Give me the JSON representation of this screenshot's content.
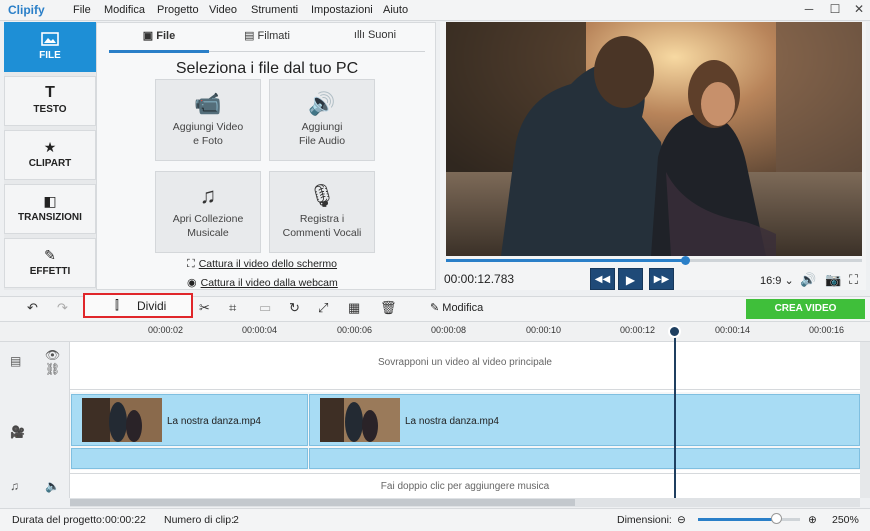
{
  "app": {
    "logo": "Clipify",
    "window_controls": [
      "─",
      "☐",
      "✕"
    ]
  },
  "menu": [
    "File",
    "Modifica",
    "Progetto",
    "Video",
    "Strumenti",
    "Impostazioni",
    "Aiuto"
  ],
  "leftnav": [
    {
      "label": "FILE",
      "icon": "image-icon",
      "active": true
    },
    {
      "label": "TESTO",
      "icon": "text-icon"
    },
    {
      "label": "CLIPART",
      "icon": "star-icon"
    },
    {
      "label": "TRANSIZIONI",
      "icon": "transition-icon"
    },
    {
      "label": "EFFETTI",
      "icon": "magic-wand-icon"
    }
  ],
  "tabs": [
    {
      "label": "File",
      "icon": "image-icon"
    },
    {
      "label": "Filmati",
      "icon": "film-icon"
    },
    {
      "label": "Suoni",
      "icon": "sound-wave-icon"
    }
  ],
  "filepanel": {
    "title": "Seleziona i file dal tuo PC",
    "tiles": [
      {
        "label": "Aggiungi Video e Foto",
        "icon": "camera-icon"
      },
      {
        "label": "Aggiungi File Audio",
        "icon": "audio-file-icon"
      },
      {
        "label": "Apri Collezione Musicale",
        "icon": "music-notes-icon"
      },
      {
        "label": "Registra i Commenti Vocali",
        "icon": "microphone-icon"
      }
    ],
    "capture_screen": "Cattura il video dello schermo",
    "capture_webcam": "Cattura il video dalla webcam"
  },
  "player": {
    "timecode": "00:00:12.783",
    "aspect": "16:9",
    "seek_progress": 0.57
  },
  "toolbar": {
    "split_label": "Dividi",
    "edit_label": "Modifica",
    "create_label": "CREA VIDEO"
  },
  "ruler": [
    "00:00:02",
    "00:00:04",
    "00:00:06",
    "00:00:08",
    "00:00:10",
    "00:00:12",
    "00:00:14",
    "00:00:16"
  ],
  "timeline": {
    "overlay_hint": "Sovrapponi un video al video principale",
    "clips": [
      {
        "name": "La nostra danza.mp4"
      },
      {
        "name": "La nostra danza.mp4"
      }
    ],
    "music_hint": "Fai doppio clic per aggiungere musica"
  },
  "status": {
    "duration_label": "Durata del progetto:",
    "duration": "00:00:22",
    "clips_label": "Numero di clip:",
    "clips": "2",
    "zoom_label": "Dimensioni:",
    "zoom": "250%",
    "zoom_level": 0.76
  },
  "colors": {
    "accent": "#1e8fd6",
    "create": "#3fbf3a",
    "split_highlight": "#e0262a"
  }
}
